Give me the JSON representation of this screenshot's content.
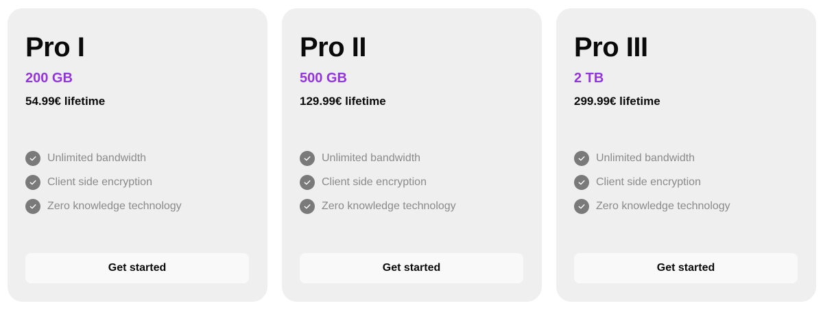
{
  "colors": {
    "accent": "#9334e0",
    "card_background": "#efefef",
    "button_background": "#f9f9f9",
    "check_icon_background": "#7a7a7a",
    "feature_text": "#8a8a8a"
  },
  "plans": [
    {
      "name": "Pro I",
      "storage": "200 GB",
      "price": "54.99€ lifetime",
      "features": [
        {
          "icon": "check-circle-icon",
          "label": "Unlimited bandwidth"
        },
        {
          "icon": "check-circle-icon",
          "label": "Client side encryption"
        },
        {
          "icon": "check-circle-icon",
          "label": "Zero knowledge technology"
        }
      ],
      "cta_label": "Get started"
    },
    {
      "name": "Pro II",
      "storage": "500 GB",
      "price": "129.99€ lifetime",
      "features": [
        {
          "icon": "check-circle-icon",
          "label": "Unlimited bandwidth"
        },
        {
          "icon": "check-circle-icon",
          "label": "Client side encryption"
        },
        {
          "icon": "check-circle-icon",
          "label": "Zero knowledge technology"
        }
      ],
      "cta_label": "Get started"
    },
    {
      "name": "Pro III",
      "storage": "2 TB",
      "price": "299.99€ lifetime",
      "features": [
        {
          "icon": "check-circle-icon",
          "label": "Unlimited bandwidth"
        },
        {
          "icon": "check-circle-icon",
          "label": "Client side encryption"
        },
        {
          "icon": "check-circle-icon",
          "label": "Zero knowledge technology"
        }
      ],
      "cta_label": "Get started"
    }
  ]
}
